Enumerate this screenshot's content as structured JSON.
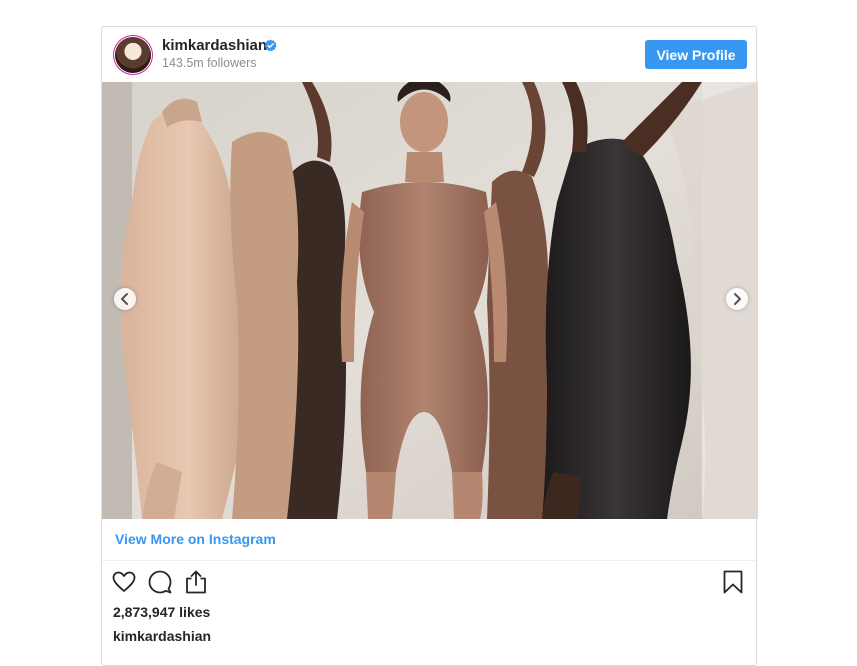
{
  "header": {
    "username": "kimkardashian",
    "followers": "143.5m followers",
    "view_profile_label": "View Profile",
    "verified_color": "#3897f0"
  },
  "media": {
    "carousel_arrows": [
      "chevron-left-icon",
      "chevron-right-icon"
    ]
  },
  "view_more_label": "View More on Instagram",
  "actions": [
    "heart-icon",
    "comment-icon",
    "share-icon",
    "bookmark-icon"
  ],
  "likes": "2,873,947 likes",
  "caption": {
    "username": "kimkardashian"
  },
  "colors": {
    "accent": "#3897f0",
    "text": "#262626",
    "muted": "#8e8e8e",
    "border": "#dbdbdb"
  }
}
